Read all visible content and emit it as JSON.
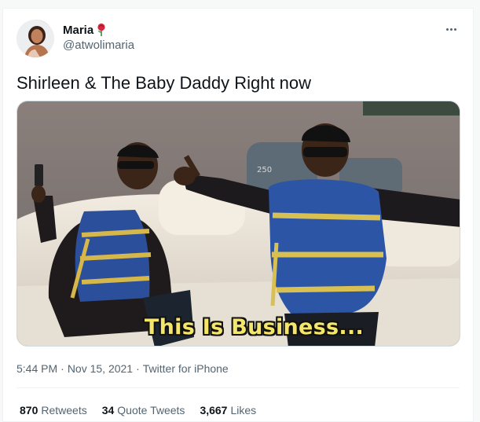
{
  "author": {
    "display_name": "Maria",
    "handle": "@atwolimaria",
    "name_emoji_icon": "rose-icon"
  },
  "tweet": {
    "text": "Shirleen & The Baby Daddy Right now",
    "media_caption": "This Is Business..."
  },
  "meta": {
    "time": "5:44 PM",
    "date": "Nov 15, 2021",
    "source": "Twitter for iPhone",
    "separator": "·"
  },
  "stats": {
    "retweets_count": "870",
    "retweets_label": "Retweets",
    "quotes_count": "34",
    "quotes_label": "Quote Tweets",
    "likes_count": "3,667",
    "likes_label": "Likes"
  },
  "colors": {
    "primary_text": "#0f1419",
    "secondary_text": "#536471",
    "caption_yellow": "#f4e66b"
  },
  "icons": [
    "rose-icon",
    "more-options-icon"
  ]
}
